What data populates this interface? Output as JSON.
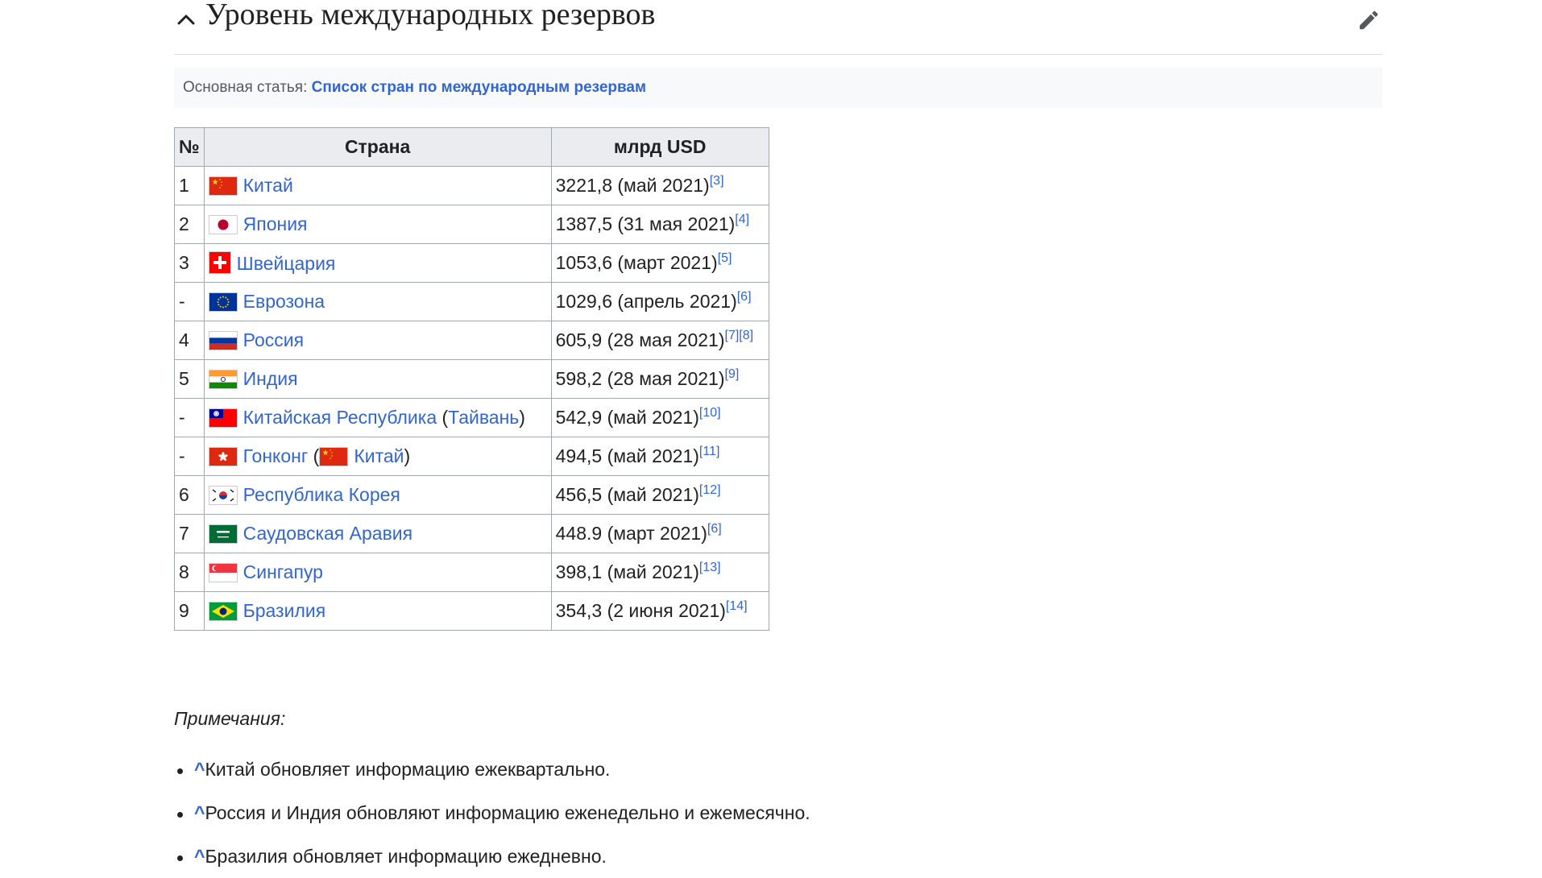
{
  "section": {
    "title": "Уровень международных резервов",
    "collapse_icon": "chevron-up-icon",
    "edit_icon": "pencil-icon"
  },
  "hatnote": {
    "prefix": "Основная статья:",
    "link_text": "Список стран по международным резервам"
  },
  "table": {
    "headers": {
      "rank": "№",
      "country": "Страна",
      "value": "млрд USD"
    },
    "rows": [
      {
        "rank": "1",
        "flag": "china",
        "country": "Китай",
        "value": "3221,8 (май 2021)",
        "refs": [
          "[3]"
        ]
      },
      {
        "rank": "2",
        "flag": "japan",
        "country": "Япония",
        "value": "1387,5 (31 мая 2021)",
        "refs": [
          "[4]"
        ]
      },
      {
        "rank": "3",
        "flag": "switzerland",
        "country": "Швейцария",
        "value": "1053,6 (март 2021)",
        "refs": [
          "[5]"
        ]
      },
      {
        "rank": "-",
        "flag": "eu",
        "country": "Еврозона",
        "value": "1029,6 (апрель 2021)",
        "refs": [
          "[6]"
        ]
      },
      {
        "rank": "4",
        "flag": "russia",
        "country": "Россия",
        "value": "605,9 (28 мая 2021)",
        "refs": [
          "[7]",
          "[8]"
        ]
      },
      {
        "rank": "5",
        "flag": "india",
        "country": "Индия",
        "value": "598,2 (28 мая 2021)",
        "refs": [
          "[9]"
        ]
      },
      {
        "rank": "-",
        "flag": "taiwan",
        "country": "Китайская Республика",
        "paren_link": "Тайвань",
        "value": "542,9 (май 2021)",
        "refs": [
          "[10]"
        ]
      },
      {
        "rank": "-",
        "flag": "hongkong",
        "country": "Гонконг",
        "paren_flag": "china",
        "paren_link": "Китай",
        "value": "494,5 (май 2021)",
        "refs": [
          "[11]"
        ]
      },
      {
        "rank": "6",
        "flag": "korea",
        "country": "Республика Корея",
        "value": "456,5 (май 2021)",
        "refs": [
          "[12]"
        ]
      },
      {
        "rank": "7",
        "flag": "saudi",
        "country": "Саудовская Аравия",
        "value": "448.9 (март 2021)",
        "refs": [
          "[6]"
        ]
      },
      {
        "rank": "8",
        "flag": "singapore",
        "country": "Сингапур",
        "value": "398,1 (май 2021)",
        "refs": [
          "[13]"
        ]
      },
      {
        "rank": "9",
        "flag": "brazil",
        "country": "Бразилия",
        "value": "354,3 (2 июня 2021)",
        "refs": [
          "[14]"
        ]
      }
    ]
  },
  "notes": {
    "heading": "Примечания:",
    "caret": "^",
    "items": [
      "Китай обновляет информацию ежеквартально.",
      "Россия и Индия обновляют информацию еженедельно и ежемесячно.",
      "Бразилия обновляет информацию ежедневно."
    ]
  },
  "colors": {
    "link": "#3366cc",
    "text": "#202122",
    "header_bg": "#eaecf0",
    "border": "#a2a9b1"
  }
}
